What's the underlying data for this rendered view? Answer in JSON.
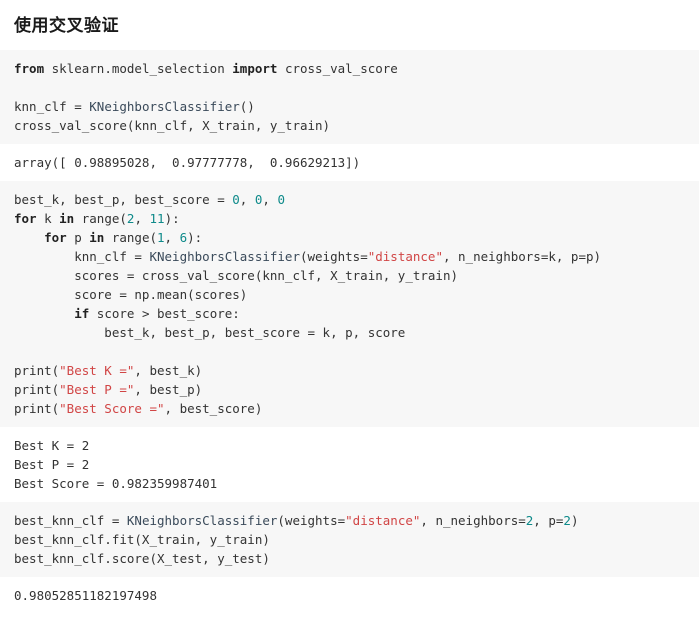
{
  "page": {
    "title": "使用交叉验证",
    "background": "#ffffff",
    "code_block_background": "#f7f7f7"
  },
  "colors": {
    "keyword": "#222222",
    "string": "#d14545",
    "number": "#0e8a8a",
    "class_name": "#3a4a5a",
    "plain_text": "#333333",
    "heading": "#1a1a1a"
  },
  "blocks": {
    "code_1": {
      "lines": [
        "from sklearn.model_selection import cross_val_score",
        "",
        "knn_clf = KNeighborsClassifier()",
        "cross_val_score(knn_clf, X_train, y_train)"
      ],
      "tokens": {
        "from": "from",
        "import": "import",
        "module": " sklearn.model_selection ",
        "imported_name": " cross_val_score",
        "knn_assign": "knn_clf = ",
        "classifier": "KNeighborsClassifier",
        "classifier_args": "()",
        "cv_call": "cross_val_score(knn_clf, X_train, y_train)"
      }
    },
    "output_1": {
      "text": "array([ 0.98895028,  0.97777778,  0.96629213])"
    },
    "code_2": {
      "lines": [
        "best_k, best_p, best_score = 0, 0, 0",
        "for k in range(2, 11):",
        "    for p in range(1, 6):",
        "        knn_clf = KNeighborsClassifier(weights=\"distance\", n_neighbors=k, p=p)",
        "        scores = cross_val_score(knn_clf, X_train, y_train)",
        "        score = np.mean(scores)",
        "        if score > best_score:",
        "            best_k, best_p, best_score = k, p, score",
        "",
        "print(\"Best K =\", best_k)",
        "print(\"Best P =\", best_p)",
        "print(\"Best Score =\", best_score)"
      ],
      "tokens": {
        "init_vars": "best_k, best_p, best_score = ",
        "zero": "0",
        "comma_sep": ", ",
        "kw_for": "for",
        "kw_in": "in",
        "kw_if": "if",
        "var_k": " k ",
        "var_p": " p ",
        "range_open": " range(",
        "range_k_start": "2",
        "range_k_end": "11",
        "range_p_start": "1",
        "range_p_end": "6",
        "range_close": "):",
        "knn_assign": "        knn_clf = ",
        "classifier": "KNeighborsClassifier",
        "weights_arg": "(weights=",
        "distance_str": "\"distance\"",
        "neighbors_k": ", n_neighbors=k, p=p)",
        "scores_line": "        scores = cross_val_score(knn_clf, X_train, y_train)",
        "score_mean": "        score = np.mean(scores)",
        "if_cond": " score > best_score:",
        "assign_best": "            best_k, best_p, best_score = k, p, score",
        "print_open": "print(",
        "str_best_k": "\"Best K =\"",
        "str_best_p": "\"Best P =\"",
        "str_best_score": "\"Best Score =\"",
        "print_k_tail": ", best_k)",
        "print_p_tail": ", best_p)",
        "print_score_tail": ", best_score)"
      }
    },
    "output_2": {
      "lines": [
        "Best K = 2",
        "Best P = 2",
        "Best Score = 0.982359987401"
      ]
    },
    "code_3": {
      "lines": [
        "best_knn_clf = KNeighborsClassifier(weights=\"distance\", n_neighbors=2, p=2)",
        "best_knn_clf.fit(X_train, y_train)",
        "best_knn_clf.score(X_test, y_test)"
      ],
      "tokens": {
        "assign": "best_knn_clf = ",
        "classifier": "KNeighborsClassifier",
        "weights_arg": "(weights=",
        "distance_str": "\"distance\"",
        "mid": ", n_neighbors=",
        "n_neighbors_val": "2",
        "p_label": ", p=",
        "p_val": "2",
        "close": ")",
        "fit_line": "best_knn_clf.fit(X_train, y_train)",
        "score_line": "best_knn_clf.score(X_test, y_test)"
      }
    },
    "output_3": {
      "text": "0.98052851182197498"
    }
  }
}
